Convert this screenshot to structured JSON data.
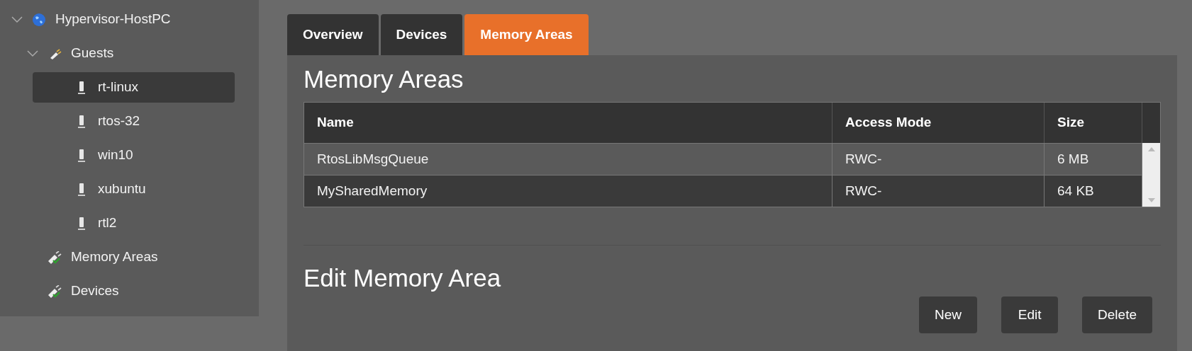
{
  "tree": [
    {
      "label": "Hypervisor-HostPC",
      "kind": "host",
      "expanded": true,
      "selected": false,
      "children": [
        {
          "label": "Guests",
          "kind": "group",
          "expanded": true,
          "selected": false,
          "children": [
            {
              "label": "rt-linux",
              "kind": "guest",
              "selected": true
            },
            {
              "label": "rtos-32",
              "kind": "guest",
              "selected": false
            },
            {
              "label": "win10",
              "kind": "guest",
              "selected": false
            },
            {
              "label": "xubuntu",
              "kind": "guest",
              "selected": false
            },
            {
              "label": "rtl2",
              "kind": "guest",
              "selected": false
            }
          ]
        },
        {
          "label": "Memory Areas",
          "kind": "resource",
          "selected": false
        },
        {
          "label": "Devices",
          "kind": "resource",
          "selected": false
        }
      ]
    }
  ],
  "tabs": [
    {
      "label": "Overview",
      "selected": false
    },
    {
      "label": "Devices",
      "selected": false
    },
    {
      "label": "Memory Areas",
      "selected": true
    }
  ],
  "heading": "Memory Areas",
  "table": {
    "columns": [
      "Name",
      "Access Mode",
      "Size"
    ],
    "rows": [
      [
        "RtosLibMsgQueue",
        "RWC-",
        "6 MB"
      ],
      [
        "MySharedMemory",
        "RWC-",
        "64 KB"
      ]
    ]
  },
  "edit_heading": "Edit Memory Area",
  "buttons": [
    "New",
    "Edit",
    "Delete"
  ]
}
